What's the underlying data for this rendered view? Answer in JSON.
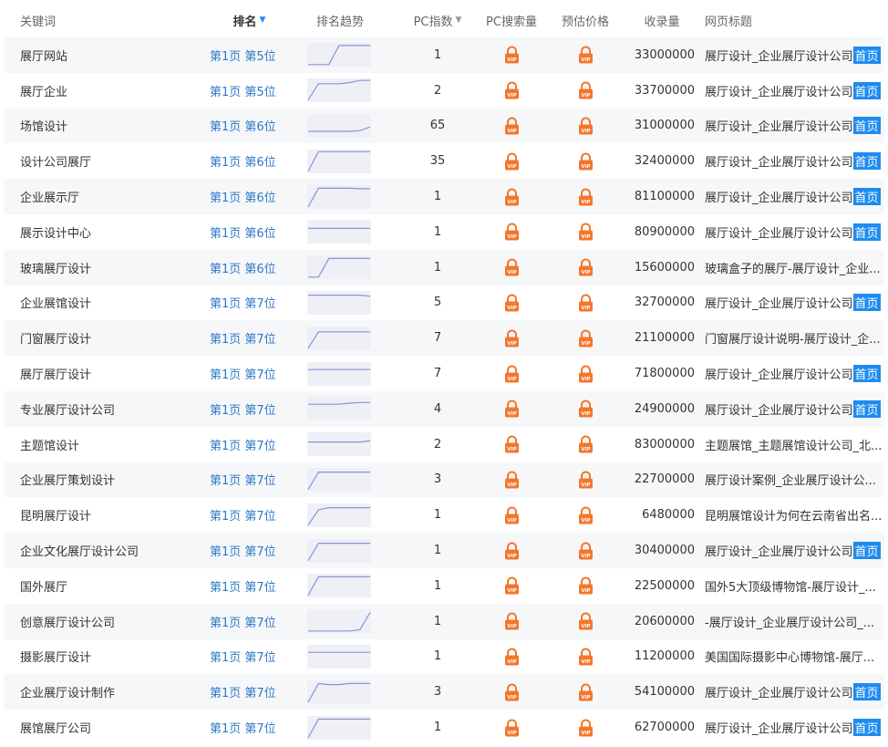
{
  "header": {
    "keyword": "关键词",
    "rank": "排名",
    "trend": "排名趋势",
    "pc_index": "PC指数",
    "pc_search": "PC搜索量",
    "price": "预估价格",
    "indexed": "收录量",
    "page_title": "网页标题"
  },
  "colors": {
    "link": "#2d78c8",
    "accent": "#1e8bf0",
    "lock": "#f5762a",
    "trend_bg": "#eef0f6",
    "trend_line": "#8a93d6"
  },
  "icons": {
    "sort": "triangle-down-icon",
    "locked": "vip-lock-icon"
  },
  "rows": [
    {
      "keyword": "展厅网站",
      "rank": "第1页 第5位",
      "trend": [
        0.95,
        0.95,
        0.95,
        0.08,
        0.08,
        0.08,
        0.08
      ],
      "pc_index": "1",
      "indexed": "33000000",
      "title": "展厅设计_企业展厅设计公司",
      "home": "首页"
    },
    {
      "keyword": "展厅企业",
      "rank": "第1页 第5位",
      "trend": [
        0.95,
        0.2,
        0.2,
        0.2,
        0.15,
        0.05,
        0.05
      ],
      "pc_index": "2",
      "indexed": "33700000",
      "title": "展厅设计_企业展厅设计公司",
      "home": "首页"
    },
    {
      "keyword": "场馆设计",
      "rank": "第1页 第6位",
      "trend": [
        0.75,
        0.75,
        0.75,
        0.75,
        0.75,
        0.72,
        0.55
      ],
      "pc_index": "65",
      "indexed": "31000000",
      "title": "展厅设计_企业展厅设计公司",
      "home": "首页"
    },
    {
      "keyword": "设计公司展厅",
      "rank": "第1页 第6位",
      "trend": [
        0.95,
        0.05,
        0.05,
        0.05,
        0.05,
        0.05,
        0.05
      ],
      "pc_index": "35",
      "indexed": "32400000",
      "title": "展厅设计_企业展厅设计公司",
      "home": "首页"
    },
    {
      "keyword": "企业展示厅",
      "rank": "第1页 第6位",
      "trend": [
        0.95,
        0.1,
        0.1,
        0.1,
        0.1,
        0.12,
        0.12
      ],
      "pc_index": "1",
      "indexed": "81100000",
      "title": "展厅设计_企业展厅设计公司",
      "home": "首页"
    },
    {
      "keyword": "展示设计中心",
      "rank": "第1页 第6位",
      "trend": [
        0.35,
        0.35,
        0.35,
        0.35,
        0.35,
        0.35,
        0.35
      ],
      "pc_index": "1",
      "indexed": "80900000",
      "title": "展厅设计_企业展厅设计公司",
      "home": "首页"
    },
    {
      "keyword": "玻璃展厅设计",
      "rank": "第1页 第6位",
      "trend": [
        0.95,
        0.95,
        0.1,
        0.1,
        0.1,
        0.1,
        0.1
      ],
      "pc_index": "1",
      "indexed": "15600000",
      "title": "玻璃盒子的展厅-展厅设计_企业...",
      "home": ""
    },
    {
      "keyword": "企业展馆设计",
      "rank": "第1页 第7位",
      "trend": [
        0.15,
        0.15,
        0.15,
        0.15,
        0.15,
        0.15,
        0.2
      ],
      "pc_index": "5",
      "indexed": "32700000",
      "title": "展厅设计_企业展厅设计公司",
      "home": "首页"
    },
    {
      "keyword": "门窗展厅设计",
      "rank": "第1页 第7位",
      "trend": [
        0.95,
        0.2,
        0.2,
        0.2,
        0.2,
        0.2,
        0.2
      ],
      "pc_index": "7",
      "indexed": "21100000",
      "title": "门窗展厅设计说明-展厅设计_企...",
      "home": ""
    },
    {
      "keyword": "展厅展厅设计",
      "rank": "第1页 第7位",
      "trend": [
        0.3,
        0.3,
        0.3,
        0.3,
        0.3,
        0.3,
        0.3
      ],
      "pc_index": "7",
      "indexed": "71800000",
      "title": "展厅设计_企业展厅设计公司",
      "home": "首页"
    },
    {
      "keyword": "专业展厅设计公司",
      "rank": "第1页 第7位",
      "trend": [
        0.3,
        0.3,
        0.3,
        0.3,
        0.25,
        0.22,
        0.22
      ],
      "pc_index": "4",
      "indexed": "24900000",
      "title": "展厅设计_企业展厅设计公司",
      "home": "首页"
    },
    {
      "keyword": "主题馆设计",
      "rank": "第1页 第7位",
      "trend": [
        0.4,
        0.4,
        0.4,
        0.4,
        0.4,
        0.4,
        0.35
      ],
      "pc_index": "2",
      "indexed": "83000000",
      "title": "主题展馆_主题展馆设计公司_北...",
      "home": ""
    },
    {
      "keyword": "企业展厅策划设计",
      "rank": "第1页 第7位",
      "trend": [
        0.95,
        0.15,
        0.15,
        0.15,
        0.15,
        0.15,
        0.15
      ],
      "pc_index": "3",
      "indexed": "22700000",
      "title": "展厅设计案例_企业展厅设计公...",
      "home": ""
    },
    {
      "keyword": "昆明展厅设计",
      "rank": "第1页 第7位",
      "trend": [
        0.95,
        0.25,
        0.15,
        0.15,
        0.15,
        0.15,
        0.15
      ],
      "pc_index": "1",
      "indexed": "6480000",
      "title": "昆明展馆设计为何在云南省出名...",
      "home": ""
    },
    {
      "keyword": "企业文化展厅设计公司",
      "rank": "第1页 第7位",
      "trend": [
        0.95,
        0.15,
        0.15,
        0.15,
        0.15,
        0.15,
        0.15
      ],
      "pc_index": "1",
      "indexed": "30400000",
      "title": "展厅设计_企业展厅设计公司",
      "home": "首页"
    },
    {
      "keyword": "国外展厅",
      "rank": "第1页 第7位",
      "trend": [
        0.95,
        0.1,
        0.1,
        0.1,
        0.1,
        0.1,
        0.1
      ],
      "pc_index": "1",
      "indexed": "22500000",
      "title": "国外5大顶级博物馆-展厅设计_...",
      "home": ""
    },
    {
      "keyword": "创意展厅设计公司",
      "rank": "第1页 第7位",
      "trend": [
        0.95,
        0.95,
        0.95,
        0.95,
        0.95,
        0.9,
        0.1
      ],
      "pc_index": "1",
      "indexed": "20600000",
      "title": "-展厅设计_企业展厅设计公司_...",
      "home": ""
    },
    {
      "keyword": "摄影展厅设计",
      "rank": "第1页 第7位",
      "trend": [
        0.3,
        0.3,
        0.3,
        0.3,
        0.3,
        0.3,
        0.3
      ],
      "pc_index": "1",
      "indexed": "11200000",
      "title": "美国国际摄影中心博物馆-展厅...",
      "home": ""
    },
    {
      "keyword": "企业展厅设计制作",
      "rank": "第1页 第7位",
      "trend": [
        0.95,
        0.1,
        0.15,
        0.15,
        0.1,
        0.1,
        0.1
      ],
      "pc_index": "3",
      "indexed": "54100000",
      "title": "展厅设计_企业展厅设计公司",
      "home": "首页"
    },
    {
      "keyword": "展馆展厅公司",
      "rank": "第1页 第7位",
      "trend": [
        0.95,
        0.1,
        0.1,
        0.1,
        0.1,
        0.1,
        0.1
      ],
      "pc_index": "1",
      "indexed": "62700000",
      "title": "展厅设计_企业展厅设计公司",
      "home": "首页"
    }
  ]
}
